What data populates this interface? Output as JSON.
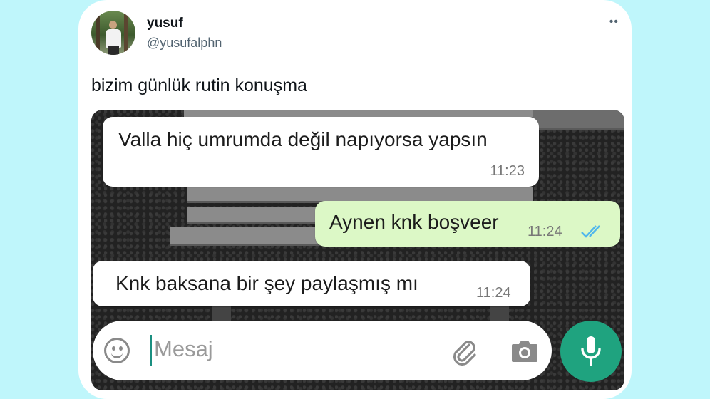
{
  "tweet": {
    "display_name": "yusuf",
    "handle": "@yusufalphn",
    "text": "bizim günlük rutin konuşma",
    "more_label": "••"
  },
  "chat": {
    "messages": [
      {
        "direction": "incoming",
        "text": "Valla hiç umrumda değil napıyorsa yapsın",
        "time": "11:23"
      },
      {
        "direction": "outgoing",
        "text": "Aynen knk boşveer",
        "time": "11:24",
        "status": "read"
      },
      {
        "direction": "incoming",
        "text": "Knk baksana bir şey paylaşmış mı",
        "time": "11:24"
      }
    ],
    "input": {
      "placeholder": "Mesaj",
      "value": ""
    }
  },
  "icons": {
    "emoji": "emoji-icon",
    "attach": "paperclip-icon",
    "camera": "camera-icon",
    "mic": "microphone-icon",
    "read_receipt": "double-check-icon"
  },
  "colors": {
    "page_background": "#bff6fb",
    "outgoing_bubble": "#dcf8c6",
    "read_tick": "#4fb6ec",
    "mic_button": "#1fa37f",
    "cursor": "#1a8f80"
  }
}
